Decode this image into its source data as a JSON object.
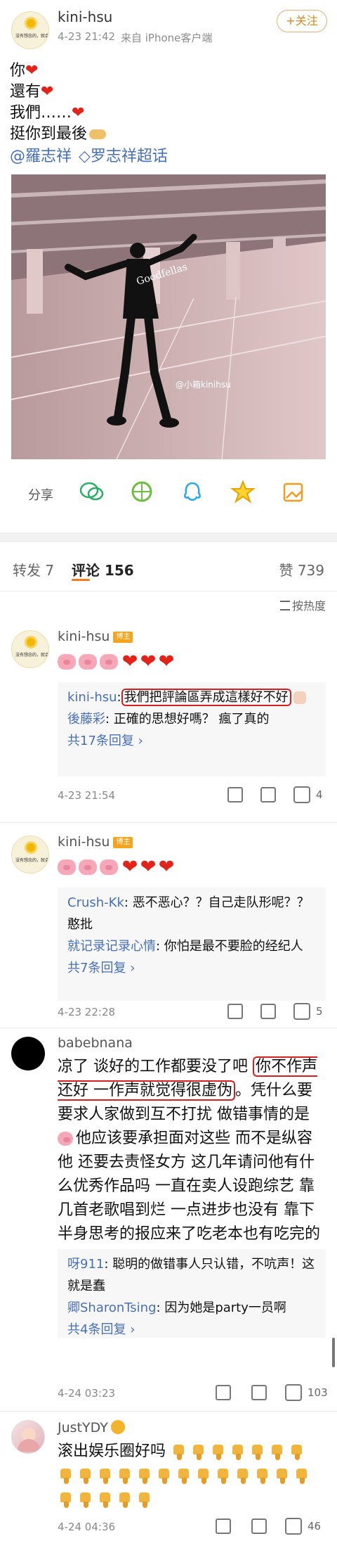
{
  "post": {
    "author": "kini-hsu",
    "timestamp": "4-23 21:42",
    "source": "来自 iPhone客户端",
    "follow_label": "+关注",
    "avatar_text": "没有想念的，就会感觉着",
    "lines": [
      "你",
      "還有",
      "我們……",
      "挺你到最後"
    ],
    "mention_line": {
      "handle": "@羅志祥",
      "topic": "◇罗志祥超话"
    },
    "image_watermark": "@小箱kinihsu",
    "image_shirt_text": "Goodfellas",
    "share_label": "分享",
    "share_icons": [
      "wechat-icon",
      "moments-icon",
      "qq-icon",
      "qzone-icon",
      "album-icon"
    ]
  },
  "tabs": {
    "repost": "转发 7",
    "comment_label": "评论",
    "comment_count": "156",
    "like": "赞 739",
    "sort_label": "按热度"
  },
  "comments": [
    {
      "name": "kini-hsu",
      "badge": "博主",
      "reactions": [
        "pig-emoji",
        "pig-emoji",
        "pig-emoji",
        "heart-emoji",
        "heart-emoji",
        "heart-emoji"
      ],
      "replies": [
        {
          "name": "kini-hsu",
          "text": "我們把評論區弄成這樣好不好"
        },
        {
          "name": "後藤彩",
          "text": "正確的思想好嗎？ 瘋了真的"
        }
      ],
      "more": "共17条回复",
      "time": "4-23 21:54",
      "likes": "4"
    },
    {
      "name": "kini-hsu",
      "badge": "博主",
      "reactions": [
        "pig-emoji",
        "pig-emoji",
        "pig-emoji",
        "heart-emoji",
        "heart-emoji",
        "heart-emoji"
      ],
      "replies": [
        {
          "name": "Crush-Kk",
          "text": "恶不恶心？？自己走队形呢？？憨批"
        },
        {
          "name": "就记录记录心情",
          "text": "你怕是最不要脸的经纪人"
        }
      ],
      "more": "共7条回复",
      "time": "4-23 22:28",
      "likes": "5"
    },
    {
      "name": "babebnana",
      "text_parts": {
        "part1": "凉了 谈好的工作都要没了吧 ",
        "highlight1": "你不作声还好 一作声就觉得很虚伪",
        "part2": "。凭什么要要求人家做到互不打扰 做错事情的是",
        "part3": "他应该要承担面对这些 而不是纵容他 还要去责怪女方 这几年请问他有什么优秀作品吗 一直在卖人设跑综艺 靠几首老歌唱到烂 一点进步也没有 靠下半身思考的报应来了吃老本也有吃完的一天"
      },
      "replies": [
        {
          "name": "呀911",
          "text": "聪明的做错事人只认错，不吭声！这就是蠢"
        },
        {
          "name": "卿SharonTsing",
          "text": "因为她是party一员啊"
        }
      ],
      "more": "共4条回复",
      "time": "4-24 03:23",
      "likes": "103"
    },
    {
      "name": "JustYDY",
      "text": "滚出娱乐圈好吗",
      "time": "4-24 04:36",
      "likes": "46"
    }
  ]
}
